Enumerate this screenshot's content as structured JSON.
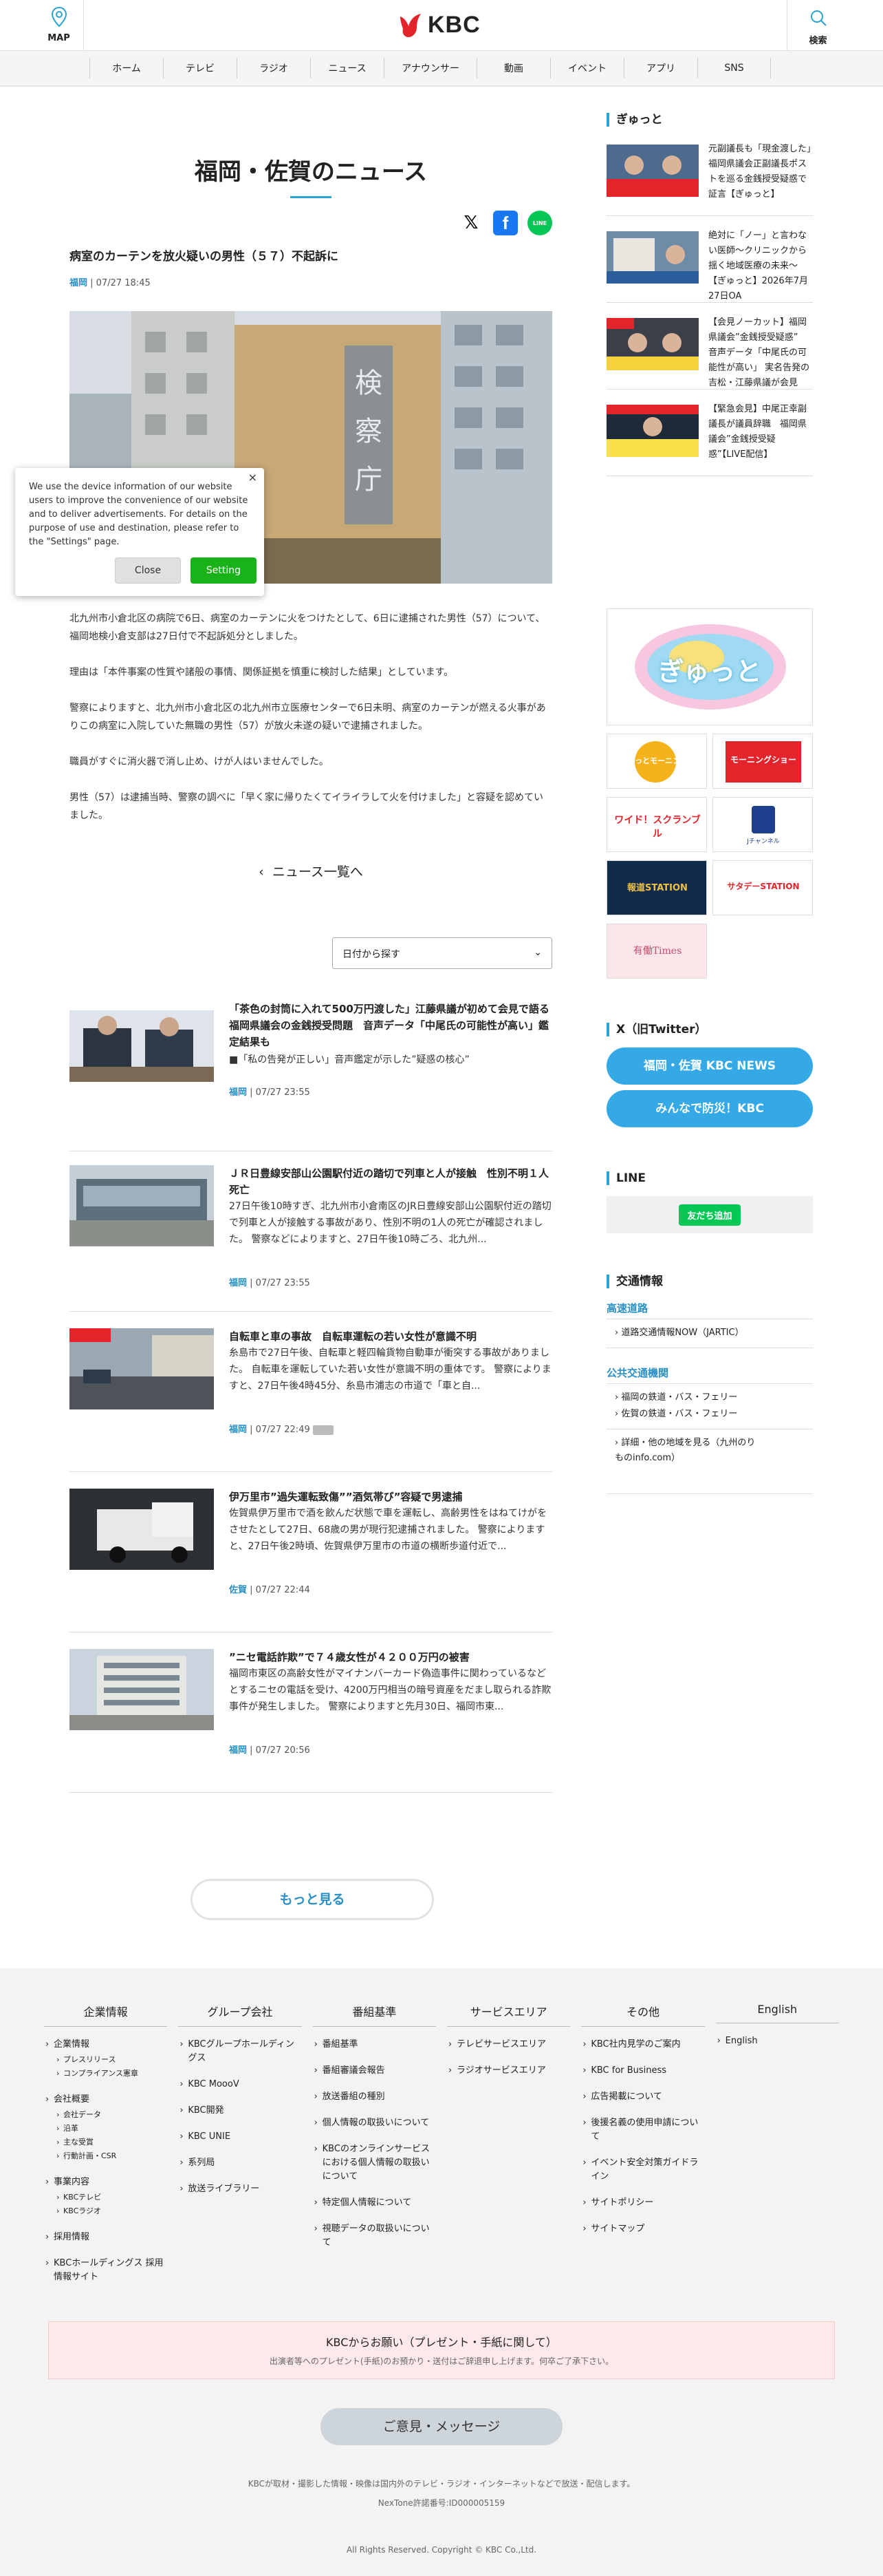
{
  "header": {
    "map_label": "MAP",
    "logo_text": "KBC",
    "search_label": "検索"
  },
  "nav": [
    "ホーム",
    "テレビ",
    "ラジオ",
    "ニュース",
    "アナウンサー",
    "動画",
    "イベント",
    "アプリ",
    "SNS"
  ],
  "page_title": "福岡・佐賀のニュース",
  "article": {
    "title": "病室のカーテンを放火疑いの男性（５７）不起訴に",
    "pref": "福岡",
    "date": "07/27 18:45",
    "photo_sign": "検察庁",
    "paragraphs": [
      "北九州市小倉北区の病院で6日、病室のカーテンに火をつけたとして、6日に逮捕された男性（57）について、福岡地検小倉支部は27日付で不起訴処分としました。",
      "理由は「本件事案の性質や諸般の事情、関係証拠を慎重に検討した結果」としています。",
      "警察によりますと、北九州市小倉北区の北九州市立医療センターで6日未明、病室のカーテンが燃える火事がありこの病室に入院していた無職の男性（57）が放火未遂の疑いで逮捕されました。",
      "職員がすぐに消火器で消し止め、けが人はいませんでした。",
      "男性（57）は逮捕当時、警察の調べに「早く家に帰りたくてイライラして火を付けました」と容疑を認めていました。"
    ]
  },
  "share": {
    "x": "𝕏",
    "facebook": "f",
    "line": "LINE"
  },
  "cookie": {
    "text": "We use the device information of our website users to improve the convenience of our website and to deliver advertisements. For details on the purpose of use and destination, please refer to the \"Settings\" page.",
    "close": "Close",
    "setting": "Setting",
    "x": "×"
  },
  "back_label": "ニュース一覧へ",
  "date_select": "日付から探す",
  "news": [
    {
      "title": "「茶色の封筒に入れて500万円渡した」江藤県議が初めて会見で語る　福岡県議会の金銭授受問題　音声データ「中尾氏の可能性が高い」鑑定結果も",
      "desc": "■「私の告発が正しい」音声鑑定が示した”疑惑の核心”",
      "pref": "福岡",
      "date": "07/27 23:55"
    },
    {
      "title": "ＪＲ日豊線安部山公園駅付近の踏切で列車と人が接触　性別不明１人死亡",
      "desc": "27日午後10時すぎ、北九州市小倉南区のJR日豊線安部山公園駅付近の踏切で列車と人が接触する事故があり、性別不明の1人の死亡が確認されました。 警察などによりますと、27日午後10時ごろ、北九州...",
      "pref": "福岡",
      "date": "07/27 23:55"
    },
    {
      "title": "自転車と車の事故　自転車運転の若い女性が意識不明",
      "desc": "糸島市で27日午後、自転車と軽四輪貨物自動車が衝突する事故がありました。 自転車を運転していた若い女性が意識不明の重体です。 警察によりますと、27日午後4時45分、糸島市浦志の市道で「車と自...",
      "pref": "福岡",
      "date": "07/27 22:49"
    },
    {
      "title": "伊万里市”過失運転致傷””酒気帯び”容疑で男逮捕",
      "desc": "佐賀県伊万里市で酒を飲んだ状態で車を運転し、高齢男性をはねてけがをさせたとして27日、68歳の男が現行犯逮捕されました。 警察によりますと、27日午後2時頃、佐賀県伊万里市の市道の横断歩道付近で...",
      "pref": "佐賀",
      "date": "07/27 22:44"
    },
    {
      "title": "”ニセ電話詐欺”で７４歳女性が４２００万円の被害",
      "desc": "福岡市東区の高齢女性がマイナンバーカード偽造事件に関わっているなどとするニセの電話を受け、4200万円相当の暗号資産をだまし取られる詐欺事件が発生しました。 警察によりますと先月30日、福岡市東...",
      "pref": "福岡",
      "date": "07/27 20:56"
    }
  ],
  "more_label": "もっと見る",
  "sidebar": {
    "gyutto_heading": "ぎゅっと",
    "gyutto": [
      {
        "text": "元副議長も「現金渡した」福岡県議会正副議長ポストを巡る金銭授受疑惑で証言【ぎゅっと】"
      },
      {
        "text": "絶対に「ノー」と言わない医師～クリニックから揺く地域医療の未来～【ぎゅっと】2026年7月27日OA"
      },
      {
        "text": "【会見ノーカット】福岡県議会”金銭授受疑惑”　音声データ「中尾氏の可能性が高い」 実名告発の吉松・江藤県議が会見"
      },
      {
        "text": "【緊急会見】中尾正幸副議長が議員辞職　福岡県議会”金銭授受疑惑”【LIVE配信】"
      }
    ],
    "banners": [
      "ぎゅっと",
      "ぐっとモーニング",
      "モーニングショー",
      "ワイド！スクランブル",
      "Jチャンネル",
      "報道STATION",
      "サタデーSTATION",
      "有働Times"
    ],
    "x_heading": "X（旧Twitter）",
    "x_buttons": [
      "福岡・佐賀 KBC NEWS",
      "みんなで防災！KBC"
    ],
    "line_heading": "LINE",
    "line_button": "友だち追加",
    "traffic_heading": "交通情報",
    "highway": "高速道路",
    "highway_items": [
      "道路交通情報NOW（JARTIC）"
    ],
    "transit": "公共交通機関",
    "transit_items": [
      "福岡の鉄道・バス・フェリー",
      "佐賀の鉄道・バス・フェリー"
    ],
    "more_transit": "詳細・他の地域を見る（九州のりものinfo.com）"
  },
  "footer": {
    "cols": [
      {
        "title": "企業情報",
        "groups": [
          {
            "label": "企業情報",
            "subs": [
              "プレスリリース",
              "コンプライアンス憲章"
            ]
          },
          {
            "label": "会社概要",
            "subs": [
              "会社データ",
              "沿革",
              "主な受賞",
              "行動計画・CSR"
            ]
          },
          {
            "label": "事業内容",
            "subs": [
              "KBCテレビ",
              "KBCラジオ"
            ]
          },
          {
            "label": "採用情報",
            "subs": []
          },
          {
            "label": "KBCホールディングス 採用情報サイト",
            "subs": []
          }
        ]
      },
      {
        "title": "グループ会社",
        "items": [
          "KBCグループホールディングス",
          "KBC MoooV",
          "KBC開発",
          "KBC UNIE",
          "系列局",
          "放送ライブラリー"
        ]
      },
      {
        "title": "番組基準",
        "items": [
          "番組基準",
          "番組審議会報告",
          "放送番組の種別",
          "個人情報の取扱いについて",
          "KBCのオンラインサービスにおける個人情報の取扱いについて",
          "特定個人情報について",
          "視聴データの取扱いについて"
        ]
      },
      {
        "title": "サービスエリア",
        "items": [
          "テレビサービスエリア",
          "ラジオサービスエリア"
        ]
      },
      {
        "title": "その他",
        "items": [
          "KBC社内見学のご案内",
          "KBC for Business",
          "広告掲載について",
          "後援名義の使用申請について",
          "イベント安全対策ガイドライン",
          "サイトポリシー",
          "サイトマップ"
        ]
      },
      {
        "title": "English",
        "items": [
          "English"
        ]
      }
    ],
    "notice_title": "KBCからお願い（プレゼント・手紙に関して）",
    "notice_sub": "出演者等へのプレゼント(手紙)のお預かり・送付はご辞退申し上げます。何卒ご了承下さい。",
    "opinion": "ご意見・メッセージ",
    "note1": "KBCが取材・撮影した情報・映像は国内外のテレビ・ラジオ・インターネットなどで放送・配信します。",
    "note2": "NexTone許諾番号:ID000005159",
    "copyright": "All Rights Reserved. Copyright © KBC Co.,Ltd."
  },
  "colors": {
    "accent": "#2aa4d5",
    "pref_link": "#2a8fc5",
    "line_green": "#06c755",
    "x_blue": "#34a9e6"
  }
}
